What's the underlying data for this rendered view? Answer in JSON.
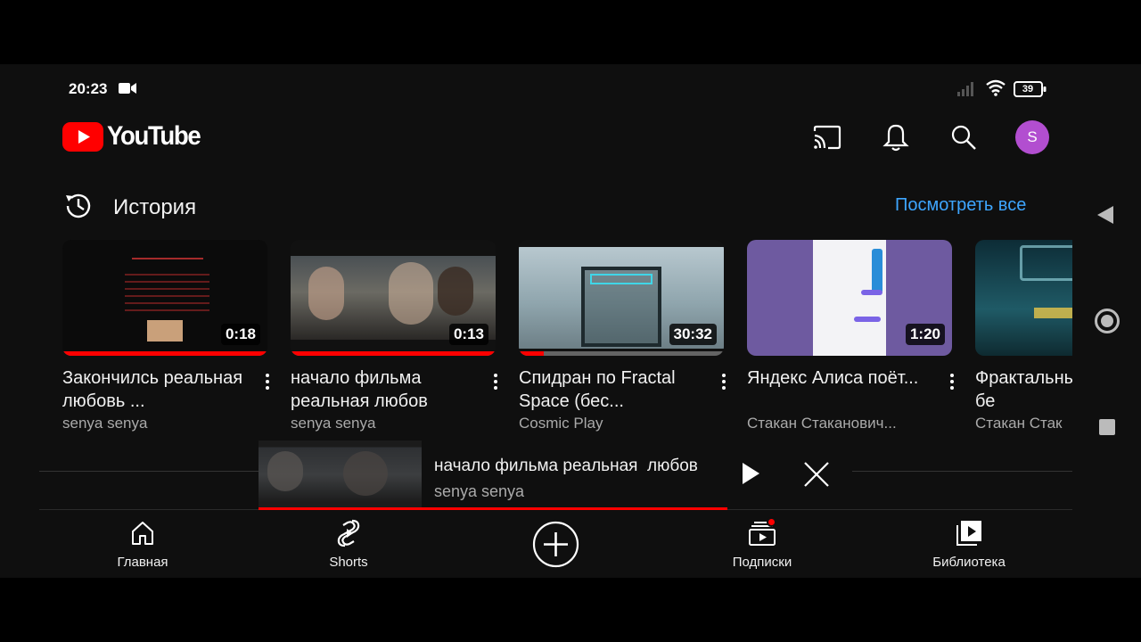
{
  "status_bar": {
    "time": "20:23",
    "battery": "39"
  },
  "header": {
    "logo_text": "YouTube",
    "avatar_letter": "S"
  },
  "history": {
    "title": "История",
    "see_all": "Посмотреть все",
    "videos": [
      {
        "title": "Закончилсь реальная любовь ...",
        "channel": "senya senya",
        "duration": "0:18",
        "progress": 1.0
      },
      {
        "title": "начало фильма реальная  любов",
        "channel": "senya senya",
        "duration": "0:13",
        "progress": 1.0
      },
      {
        "title": "Спидран по Fractal Space (бес...",
        "channel": "Cosmic Play",
        "duration": "30:32",
        "progress": 0.12
      },
      {
        "title": "Яндекс Алиса поёт...",
        "channel": "Стакан Стаканович...",
        "duration": "1:20",
        "progress": 0.0
      },
      {
        "title": "Фрактальный космос, бе",
        "channel": "Стакан Стак",
        "duration": "",
        "progress": 0.0
      }
    ]
  },
  "mini_player": {
    "title": "начало фильма реальная  любов",
    "channel": "senya senya",
    "progress": 1.0
  },
  "bottom_nav": {
    "home": "Главная",
    "shorts": "Shorts",
    "subscriptions": "Подписки",
    "library": "Библиотека"
  },
  "colors": {
    "accent_red": "#ff0000",
    "link_blue": "#3ea6ff",
    "avatar": "#b24ed0"
  }
}
